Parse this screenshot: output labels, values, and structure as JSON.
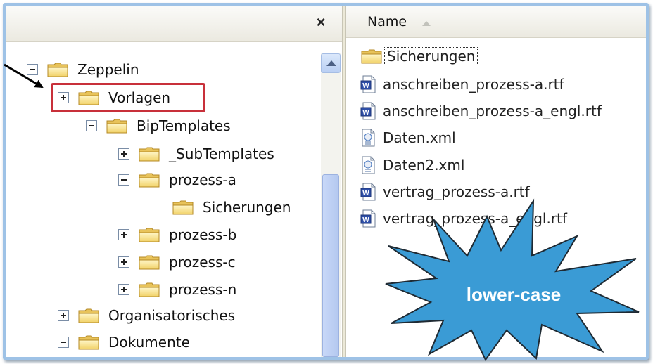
{
  "tree_pane": {
    "close_label": "×",
    "items": [
      {
        "label": "Zeppelin",
        "expander": "minus"
      },
      {
        "label": "Vorlagen",
        "expander": "plus"
      },
      {
        "label": "BipTemplates",
        "expander": "minus"
      },
      {
        "label": "_SubTemplates",
        "expander": "plus"
      },
      {
        "label": "prozess-a",
        "expander": "minus"
      },
      {
        "label": "Sicherungen",
        "expander": "none"
      },
      {
        "label": "prozess-b",
        "expander": "plus"
      },
      {
        "label": "prozess-c",
        "expander": "plus"
      },
      {
        "label": "prozess-n",
        "expander": "plus"
      },
      {
        "label": "Organisatorisches",
        "expander": "plus"
      },
      {
        "label": "Dokumente",
        "expander": "minus"
      }
    ]
  },
  "list_pane": {
    "column_name": "Name",
    "files": [
      {
        "label": "Sicherungen",
        "icon": "folder-icon"
      },
      {
        "label": "anschreiben_prozess-a.rtf",
        "icon": "word-document-icon"
      },
      {
        "label": "anschreiben_prozess-a_engl.rtf",
        "icon": "word-document-icon"
      },
      {
        "label": "Daten.xml",
        "icon": "xml-document-icon"
      },
      {
        "label": "Daten2.xml",
        "icon": "xml-document-icon"
      },
      {
        "label": "vertrag_prozess-a.rtf",
        "icon": "word-document-icon"
      },
      {
        "label": "vertrag_prozess-a_engl.rtf",
        "icon": "word-document-icon"
      }
    ]
  },
  "annotation": {
    "callout_text": "lower-case",
    "callout_color": "#3a9bd5",
    "highlight_color": "#c8303a"
  }
}
